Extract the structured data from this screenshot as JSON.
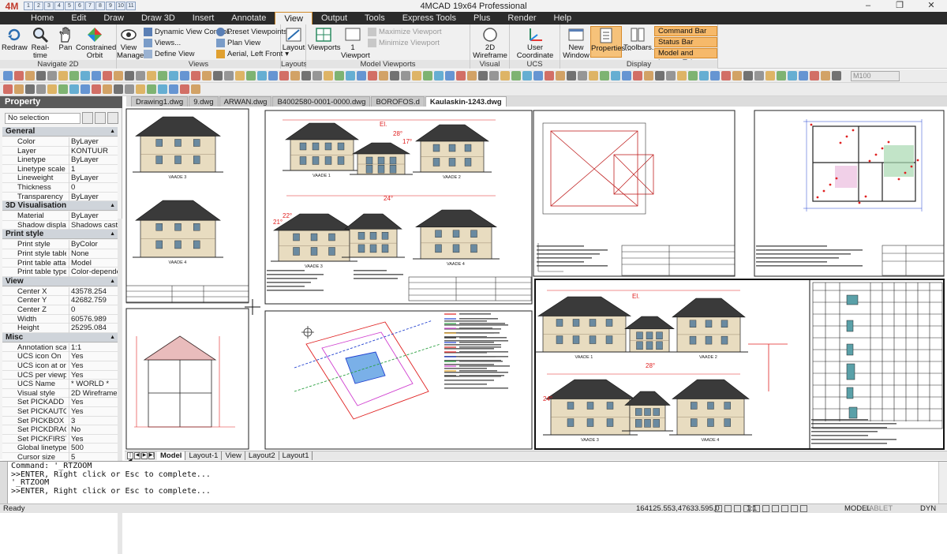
{
  "titlebar": {
    "logo": "4M",
    "qat_icons": [
      "1",
      "2",
      "3",
      "4",
      "5",
      "6",
      "7",
      "8",
      "9",
      "10",
      "11"
    ],
    "title": "4MCAD 19x64 Professional",
    "minimize": "–",
    "maximize": "❐",
    "close": "✕"
  },
  "menu": {
    "tabs": [
      "Home",
      "Edit",
      "Draw",
      "Draw 3D",
      "Insert",
      "Annotate",
      "View",
      "Output",
      "Tools",
      "Express Tools",
      "Plus",
      "Render",
      "Help"
    ],
    "active": "View"
  },
  "ribbon": {
    "navigate2d": {
      "label": "Navigate 2D",
      "redraw": "Redraw",
      "realtime_zoom": "Real-time zooming",
      "pan": "Pan",
      "constrained_orbit": "Constrained Orbit"
    },
    "views": {
      "label": "Views",
      "view_manager": "View Manager",
      "dynamic_view_control": "Dynamic View Control...",
      "views_item": "Views...",
      "define_view": "Define View",
      "preset_viewpoints": "Preset Viewpoints...",
      "plan_view": "Plan View",
      "aerial": "Aerial, Left Front"
    },
    "layouts": {
      "label": "Layouts",
      "layout": "Layout"
    },
    "model_viewports": {
      "label": "Model Viewports",
      "viewports": "Viewports",
      "one_viewport": "1 Viewport",
      "maximize_viewport": "Maximize Viewport",
      "minimize_viewport": "Minimize Viewport"
    },
    "visual_styles": {
      "label": "Visual Styles",
      "wireframe": "2D Wireframe"
    },
    "ucs": {
      "label": "UCS",
      "user_coordinate_systems": "User Coordinate Systems..."
    },
    "display": {
      "label": "Display",
      "new_window": "New Window",
      "properties": "Properties...",
      "toolbars": "Toolbars...",
      "command_bar": "Command Bar",
      "status_bar": "Status Bar",
      "model_layout_tabs": "Model and Layout Tabs"
    }
  },
  "toolbar": {
    "style_combo": "M100"
  },
  "property_panel": {
    "title": "Property",
    "selection": "No selection",
    "sections": [
      {
        "name": "General",
        "rows": [
          [
            "Color",
            "ByLayer"
          ],
          [
            "Layer",
            "KONTUUR"
          ],
          [
            "Linetype",
            "ByLayer"
          ],
          [
            "Linetype scale",
            "1"
          ],
          [
            "Lineweight",
            "ByLayer"
          ],
          [
            "Thickness",
            "0"
          ],
          [
            "Transparency",
            "ByLayer"
          ]
        ]
      },
      {
        "name": "3D Visualisation",
        "rows": [
          [
            "Material",
            "ByLayer"
          ],
          [
            "Shadow display",
            "Shadows cast and..."
          ]
        ]
      },
      {
        "name": "Print style",
        "rows": [
          [
            "Print style",
            "ByColor"
          ],
          [
            "Print style table",
            "None"
          ],
          [
            "Print table attache...",
            "Model"
          ],
          [
            "Print table type",
            "Color-dependent p..."
          ]
        ]
      },
      {
        "name": "View",
        "rows": [
          [
            "Center X",
            "43578.254"
          ],
          [
            "Center Y",
            "42682.759"
          ],
          [
            "Center Z",
            "0"
          ],
          [
            "Width",
            "60576.989"
          ],
          [
            "Height",
            "25295.084"
          ]
        ]
      },
      {
        "name": "Misc",
        "rows": [
          [
            "Annotation scale",
            "1:1"
          ],
          [
            "UCS icon On",
            "Yes"
          ],
          [
            "UCS icon at origin",
            "Yes"
          ],
          [
            "UCS per viewport",
            "Yes"
          ],
          [
            "UCS Name",
            "* WORLD *"
          ],
          [
            "Visual style",
            "2D Wireframe"
          ],
          [
            "Set PICKADD",
            "Yes"
          ],
          [
            "Set PICKAUTO",
            "Yes"
          ],
          [
            "Set PICKBOX",
            "3"
          ],
          [
            "Set PICKDRAG",
            "No"
          ],
          [
            "Set PICKFIRST",
            "Yes"
          ],
          [
            "Global linetype sc",
            "500"
          ],
          [
            "Cursor size",
            "5"
          ]
        ]
      }
    ]
  },
  "doc_tabs": [
    "Drawing1.dwg",
    "9.dwg",
    "ARWAN.dwg",
    "B4002580-0001-0000.dwg",
    "BOROFOS.d",
    "Kaulaskin-1243.dwg"
  ],
  "active_doc": "Kaulaskin-1243.dwg",
  "layout_tabs": [
    "Model",
    "Layout-1",
    "View",
    "Layout2",
    "Layout1"
  ],
  "drawing": {
    "facade_labels": [
      "VAADE 3",
      "VAADE 1",
      "VAADE 2",
      "VAADE 4"
    ],
    "elevation_marks": [
      "El.",
      "28°",
      "17°",
      "24°",
      "22°",
      "21°"
    ]
  },
  "command_lines": [
    "Command: '_RTZOOM",
    ">>ENTER, Right click or Esc to complete...",
    "'_RTZOOM",
    ">>ENTER, Right click or Esc to complete..."
  ],
  "status": {
    "ready": "Ready",
    "coords": "164125.553,47633.595,0",
    "scale": "1:1",
    "model": "MODEL",
    "tablet": "TABLET",
    "dyn": "DYN"
  },
  "colors": {
    "accent": "#d08a2a",
    "menubar": "#2b2b2b",
    "drawing_red": "#e02020",
    "drawing_blue": "#2040d0"
  }
}
